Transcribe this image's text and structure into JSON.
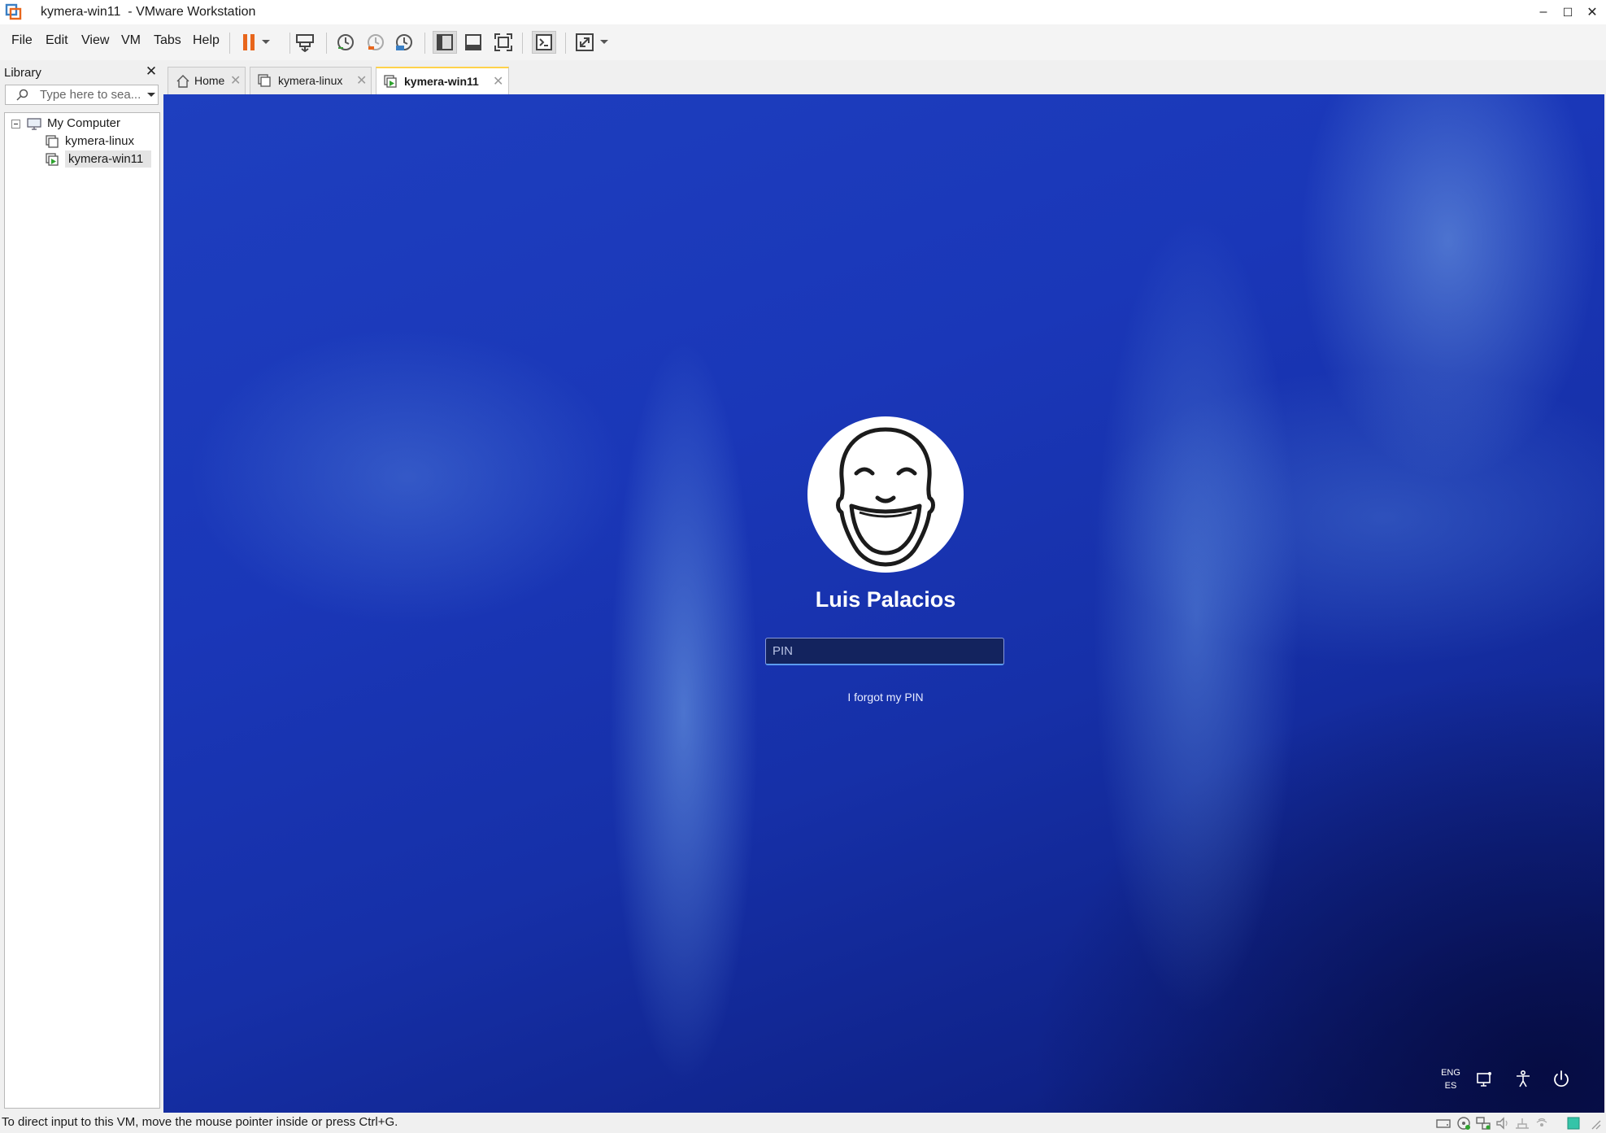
{
  "window": {
    "title": "kymera-win11  - VMware Workstation",
    "minimize_glyph": "–",
    "maximize_glyph": "☐",
    "close_glyph": "✕"
  },
  "menu": {
    "file": "File",
    "edit": "Edit",
    "view": "View",
    "vm": "VM",
    "tabs": "Tabs",
    "help": "Help"
  },
  "toolbar": {
    "icons": [
      "suspend-pause-icon",
      "power-dropdown-icon",
      "send-ctrl-alt-del-icon",
      "take-snapshot-icon",
      "revert-snapshot-icon",
      "snapshot-manager-icon",
      "show-library-icon",
      "show-thumbnail-bar-icon",
      "full-screen-icon",
      "console-view-icon",
      "stretch-guest-icon",
      "stretch-dropdown-icon"
    ],
    "pause_color": "#e8661c"
  },
  "library": {
    "title": "Library",
    "close_glyph": "✕",
    "search_placeholder": "Type here to sea...",
    "tree": {
      "root": "My Computer",
      "items": [
        "kymera-linux",
        "kymera-win11"
      ]
    }
  },
  "tabs": [
    {
      "label": "Home",
      "icon": "home-icon"
    },
    {
      "label": "kymera-linux",
      "icon": "vm-icon"
    },
    {
      "label": "kymera-win11",
      "icon": "vm-running-icon",
      "active": true
    }
  ],
  "tab_close_glyph": "✕",
  "vm_screen": {
    "user_name": "Luis Palacios",
    "pin_placeholder": "PIN",
    "forgot_pin": "I forgot my PIN",
    "language": {
      "line1": "ENG",
      "line2": "ES"
    },
    "bottom_icons": [
      "network-icon",
      "accessibility-icon",
      "power-icon"
    ]
  },
  "status": {
    "text": "To direct input to this VM, move the mouse pointer inside or press Ctrl+G.",
    "icons": [
      "hard-disk-icon",
      "cd-dvd-icon",
      "network-adapter-icon",
      "sound-icon",
      "usb-icon",
      "printer-icon",
      "message-log-icon",
      "resize-grip-icon"
    ]
  }
}
